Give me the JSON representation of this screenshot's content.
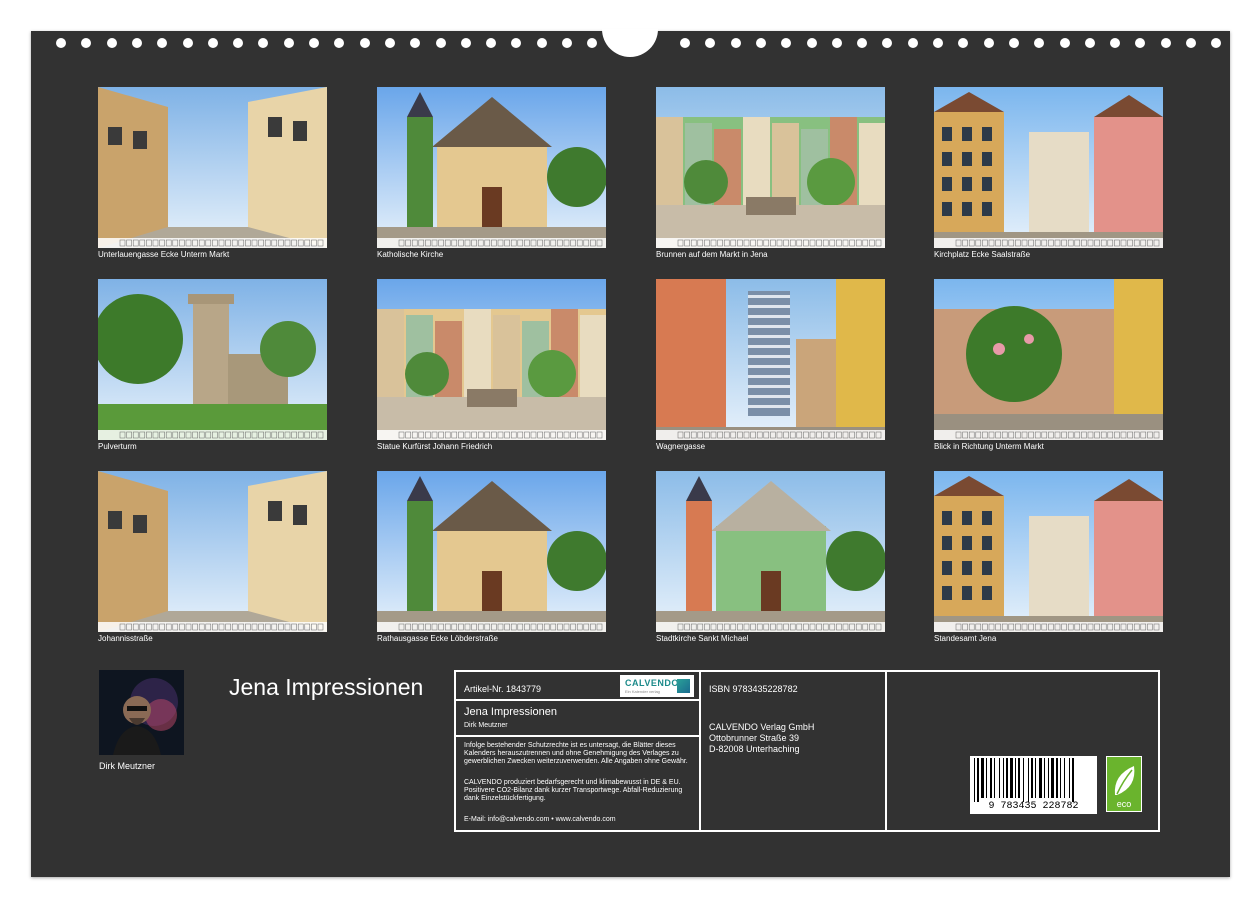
{
  "photos": [
    {
      "caption": "Unterlauengasse Ecke Unterm Markt",
      "scene": "street"
    },
    {
      "caption": "Katholische Kirche",
      "scene": "church"
    },
    {
      "caption": "Brunnen auf dem Markt in Jena",
      "scene": "square"
    },
    {
      "caption": "Kirchplatz Ecke Saalstraße",
      "scene": "houses"
    },
    {
      "caption": "Pulverturm",
      "scene": "tower"
    },
    {
      "caption": "Statue Kurfürst Johann Friedrich",
      "scene": "square"
    },
    {
      "caption": "Wagnergasse",
      "scene": "skyscraper"
    },
    {
      "caption": "Blick in Richtung Unterm Markt",
      "scene": "tree"
    },
    {
      "caption": "Johannisstraße",
      "scene": "street"
    },
    {
      "caption": "Rathausgasse Ecke Löbderstraße",
      "scene": "church"
    },
    {
      "caption": "Stadtkirche Sankt Michael",
      "scene": "church"
    },
    {
      "caption": "Standesamt Jena",
      "scene": "houses"
    }
  ],
  "author": {
    "name": "Dirk Meutzner"
  },
  "calendar_title": "Jena Impressionen",
  "info": {
    "article": "Artikel-Nr. 1843779",
    "logo": "CALVENDO",
    "logo_sub": "Ein Kalender verlag",
    "title": "Jena Impressionen",
    "author": "Dirk Meutzner",
    "legal": "Infolge bestehender Schutzrechte ist es untersagt, die Blätter dieses Kalenders herauszutrennen und ohne Genehmigung des Verlages zu gewerblichen Zwecken weiterzuverwenden. Alle Angaben ohne Gewähr.",
    "eco_text": "CALVENDO produziert bedarfsgerecht und klimabewusst in DE & EU. Positivere CO2-Bilanz dank kurzer Transportwege. Abfall-Reduzierung dank Einzelstückfertigung.",
    "contact": "E-Mail: info@calvendo.com • www.calvendo.com",
    "isbn": "ISBN 9783435228782",
    "publisher": "CALVENDO Verlag GmbH",
    "street": "Ottobrunner Straße 39",
    "city": "D-82008 Unterhaching",
    "barcode_number": "9 783435 228782",
    "eco_label": "eco"
  }
}
